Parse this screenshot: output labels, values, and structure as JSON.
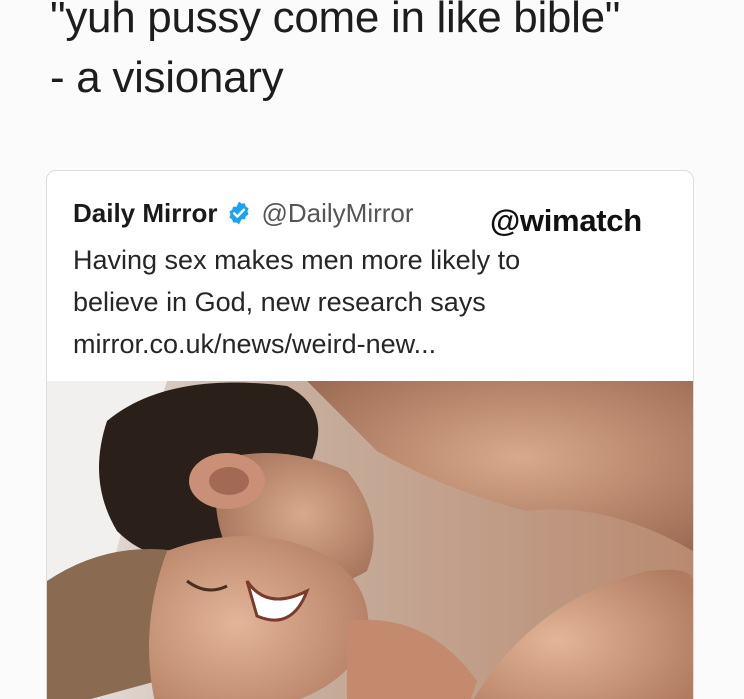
{
  "caption": {
    "line1": "\"yuh pussy come in like bible\"",
    "line2": "- a visionary"
  },
  "tweet": {
    "author_name": "Daily Mirror",
    "author_handle": "@DailyMirror",
    "text_line1": "Having sex makes men more likely to",
    "text_line2": "believe in God, new research says",
    "link": "mirror.co.uk/news/weird-new..."
  },
  "watermark": "@wimatch",
  "icons": {
    "verified": "verified-badge-icon"
  },
  "colors": {
    "verified_blue": "#1da1f2"
  }
}
